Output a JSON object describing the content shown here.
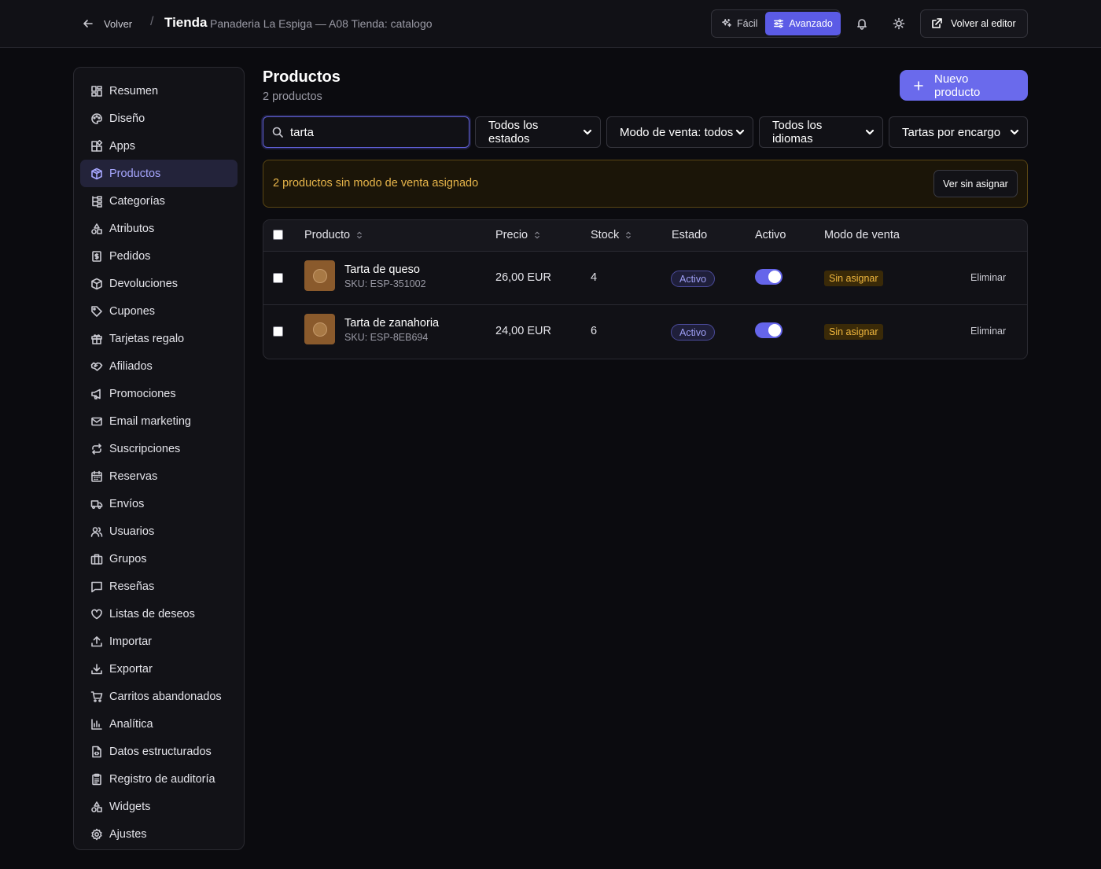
{
  "header": {
    "back_label": "Volver",
    "separator": "/",
    "title": "Tienda",
    "subtitle": "Panaderia La Espiga — A08 Tienda: catalogo",
    "modes": [
      {
        "label": "Fácil",
        "active": false
      },
      {
        "label": "Avanzado",
        "active": true
      }
    ],
    "editor_label": "Volver al editor"
  },
  "sidebar": {
    "items": [
      {
        "label": "Resumen",
        "icon": "grid-icon",
        "active": false
      },
      {
        "label": "Diseño",
        "icon": "palette-icon",
        "active": false
      },
      {
        "label": "Apps",
        "icon": "apps-icon",
        "active": false
      },
      {
        "label": "Productos",
        "icon": "package-icon",
        "active": true
      },
      {
        "label": "Categorías",
        "icon": "tree-icon",
        "active": false
      },
      {
        "label": "Atributos",
        "icon": "shapes-icon",
        "active": false
      },
      {
        "label": "Pedidos",
        "icon": "receipt-icon",
        "active": false
      },
      {
        "label": "Devoluciones",
        "icon": "package-return-icon",
        "active": false
      },
      {
        "label": "Cupones",
        "icon": "tag-icon",
        "active": false
      },
      {
        "label": "Tarjetas regalo",
        "icon": "gift-icon",
        "active": false
      },
      {
        "label": "Afiliados",
        "icon": "handshake-icon",
        "active": false
      },
      {
        "label": "Promociones",
        "icon": "megaphone-icon",
        "active": false
      },
      {
        "label": "Email marketing",
        "icon": "mail-icon",
        "active": false
      },
      {
        "label": "Suscripciones",
        "icon": "repeat-icon",
        "active": false
      },
      {
        "label": "Reservas",
        "icon": "calendar-icon",
        "active": false
      },
      {
        "label": "Envíos",
        "icon": "truck-icon",
        "active": false
      },
      {
        "label": "Usuarios",
        "icon": "users-icon",
        "active": false
      },
      {
        "label": "Grupos",
        "icon": "building-icon",
        "active": false
      },
      {
        "label": "Reseñas",
        "icon": "message-icon",
        "active": false
      },
      {
        "label": "Listas de deseos",
        "icon": "heart-icon",
        "active": false
      },
      {
        "label": "Importar",
        "icon": "upload-icon",
        "active": false
      },
      {
        "label": "Exportar",
        "icon": "download-icon",
        "active": false
      },
      {
        "label": "Carritos abandonados",
        "icon": "cart-icon",
        "active": false
      },
      {
        "label": "Analítica",
        "icon": "bar-chart-icon",
        "active": false
      },
      {
        "label": "Datos estructurados",
        "icon": "file-code-icon",
        "active": false
      },
      {
        "label": "Registro de auditoría",
        "icon": "clipboard-icon",
        "active": false
      },
      {
        "label": "Widgets",
        "icon": "shapes-icon",
        "active": false
      },
      {
        "label": "Ajustes",
        "icon": "gear-icon",
        "active": false
      }
    ]
  },
  "main": {
    "title": "Productos",
    "count": "2 productos",
    "new_button": "Nuevo producto",
    "search_value": "tarta",
    "filters": [
      {
        "label": "Todos los estados"
      },
      {
        "label": "Modo de venta: todos"
      },
      {
        "label": "Todos los idiomas"
      },
      {
        "label": "Tartas por encargo"
      }
    ],
    "alert": {
      "text": "2 productos sin modo de venta asignado",
      "button": "Ver sin asignar"
    },
    "table": {
      "headers": [
        "Producto",
        "Precio",
        "Stock",
        "Estado",
        "Activo",
        "Modo de venta"
      ],
      "rows": [
        {
          "name": "Tarta de queso",
          "sku": "SKU: ESP-351002",
          "price": "26,00 EUR",
          "stock": "4",
          "status": "Activo",
          "active": true,
          "sale_mode": "Sin asignar",
          "action": "Eliminar"
        },
        {
          "name": "Tarta de zanahoria",
          "sku": "SKU: ESP-8EB694",
          "price": "24,00 EUR",
          "stock": "6",
          "status": "Activo",
          "active": true,
          "sale_mode": "Sin asignar",
          "action": "Eliminar"
        }
      ]
    }
  },
  "colors": {
    "accent": "#6a6aec",
    "warning": "#e7b54a",
    "background": "#0b0b0f"
  }
}
